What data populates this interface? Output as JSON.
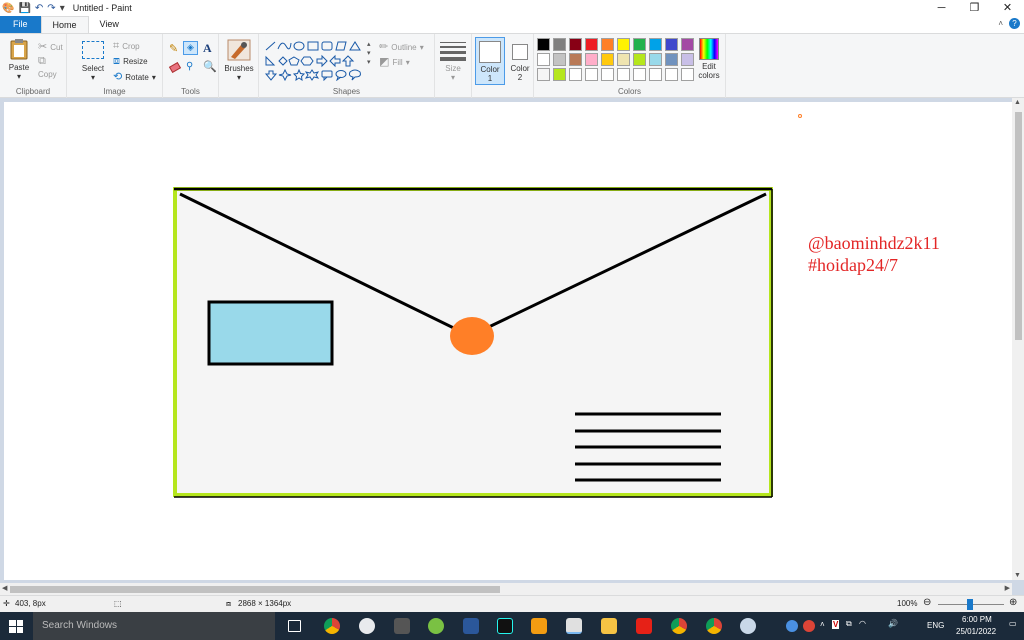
{
  "window": {
    "title": "Untitled - Paint",
    "minimize": "─",
    "maximize": "❐",
    "close": "✕"
  },
  "tabs": {
    "file": "File",
    "home": "Home",
    "view": "View"
  },
  "ribbon": {
    "clipboard": {
      "paste": "Paste",
      "cut": "Cut",
      "copy": "Copy",
      "label": "Clipboard"
    },
    "image": {
      "select": "Select",
      "crop": "Crop",
      "resize": "Resize",
      "rotate": "Rotate",
      "label": "Image"
    },
    "tools": {
      "label": "Tools"
    },
    "brushes": {
      "label": "Brushes"
    },
    "shapes": {
      "outline": "Outline",
      "fill": "Fill",
      "label": "Shapes"
    },
    "size": {
      "label": "Size"
    },
    "color1": {
      "label": "Color",
      "num": "1"
    },
    "color2": {
      "label": "Color",
      "num": "2"
    },
    "colors": {
      "label": "Colors",
      "edit1": "Edit",
      "edit2": "colors"
    }
  },
  "palette": {
    "row1": [
      "#000000",
      "#7f7f7f",
      "#880015",
      "#ed1c24",
      "#ff7f27",
      "#fff200",
      "#22b14c",
      "#00a2e8",
      "#3f48cc",
      "#a349a4"
    ],
    "row2": [
      "#ffffff",
      "#c3c3c3",
      "#b97a57",
      "#ffaec9",
      "#ffc90e",
      "#efe4b0",
      "#b5e61d",
      "#99d9ea",
      "#7092be",
      "#c8bfe7"
    ],
    "row3": [
      "#f5f5f5",
      "#b5e61d",
      "#ffffff",
      "#ffffff",
      "#ffffff",
      "#ffffff",
      "#ffffff",
      "#ffffff",
      "#ffffff",
      "#ffffff"
    ]
  },
  "drawing": {
    "line1": "@baominhdz2k11",
    "line2": "#hoidap24/7",
    "text_color": "#e32626"
  },
  "status": {
    "cursor": "403, 8px",
    "dimensions": "2868 × 1364px",
    "zoom": "100%"
  },
  "taskbar": {
    "search": "Search Windows",
    "lang": "ENG",
    "time": "6:00 PM",
    "date": "25/01/2022"
  }
}
